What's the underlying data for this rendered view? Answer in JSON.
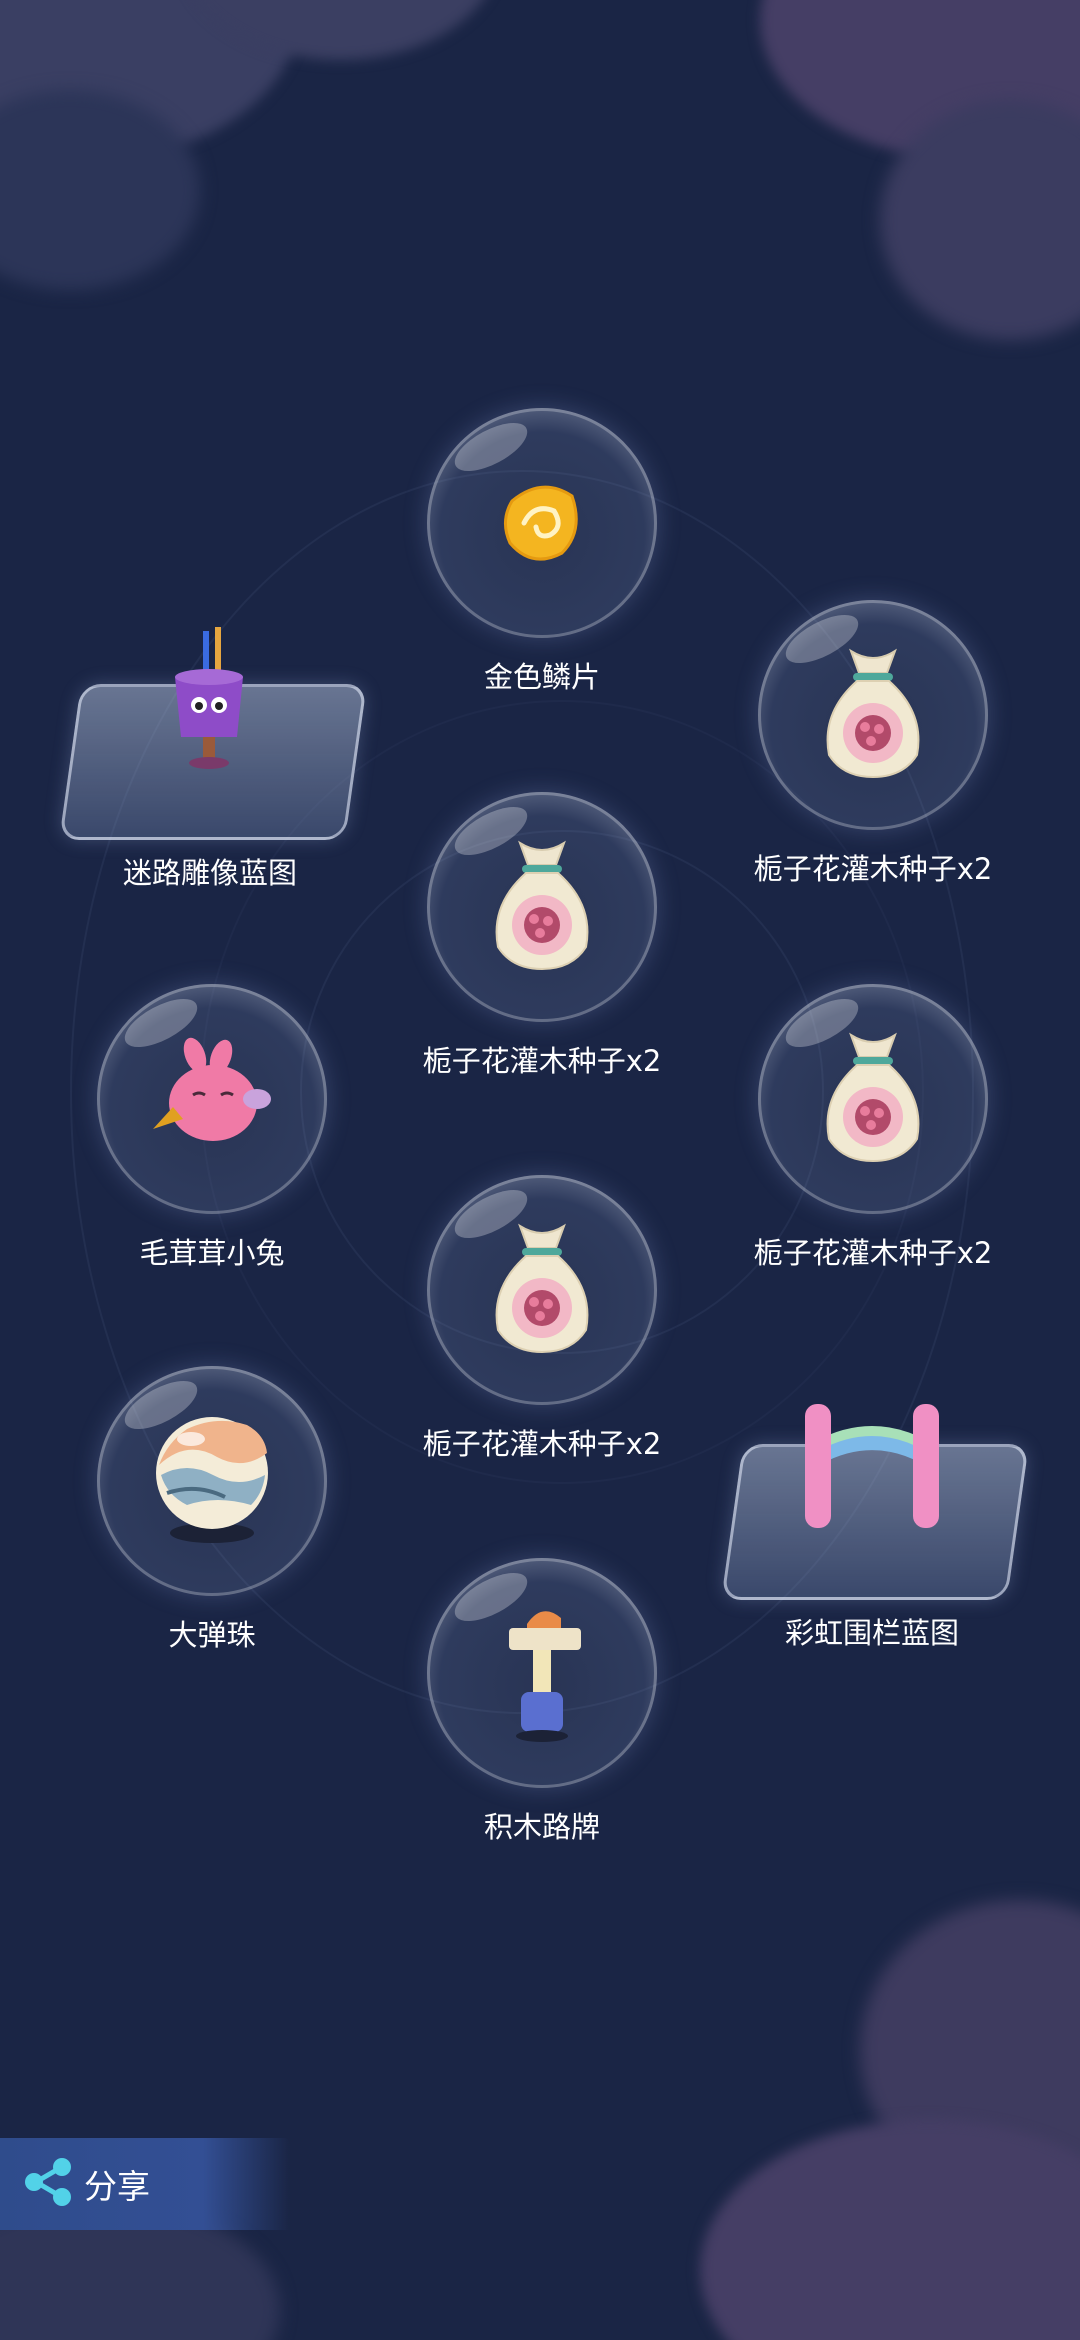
{
  "share": {
    "label": "分享",
    "icon": "share-icon"
  },
  "rewards": [
    {
      "id": "golden-scale",
      "label": "金色鳞片",
      "icon": "golden-scale-icon"
    },
    {
      "id": "maze-statue",
      "label": "迷路雕像蓝图",
      "icon": "statue-blueprint-icon"
    },
    {
      "id": "gardenia-1",
      "label": "栀子花灌木种子x2",
      "icon": "seed-bag-icon"
    },
    {
      "id": "gardenia-2",
      "label": "栀子花灌木种子x2",
      "icon": "seed-bag-icon"
    },
    {
      "id": "fluffy-bunny",
      "label": "毛茸茸小兔",
      "icon": "pink-bird-icon"
    },
    {
      "id": "gardenia-3",
      "label": "栀子花灌木种子x2",
      "icon": "seed-bag-icon"
    },
    {
      "id": "gardenia-4",
      "label": "栀子花灌木种子x2",
      "icon": "seed-bag-icon"
    },
    {
      "id": "big-marble",
      "label": "大弹珠",
      "icon": "marble-icon"
    },
    {
      "id": "rainbow-fence",
      "label": "彩虹围栏蓝图",
      "icon": "rainbow-fence-icon"
    },
    {
      "id": "block-signpost",
      "label": "积木路牌",
      "icon": "block-signpost-icon"
    }
  ],
  "colors": {
    "background": "#1a2545",
    "share_bar": "#334f94",
    "label_text": "#ffffff"
  }
}
